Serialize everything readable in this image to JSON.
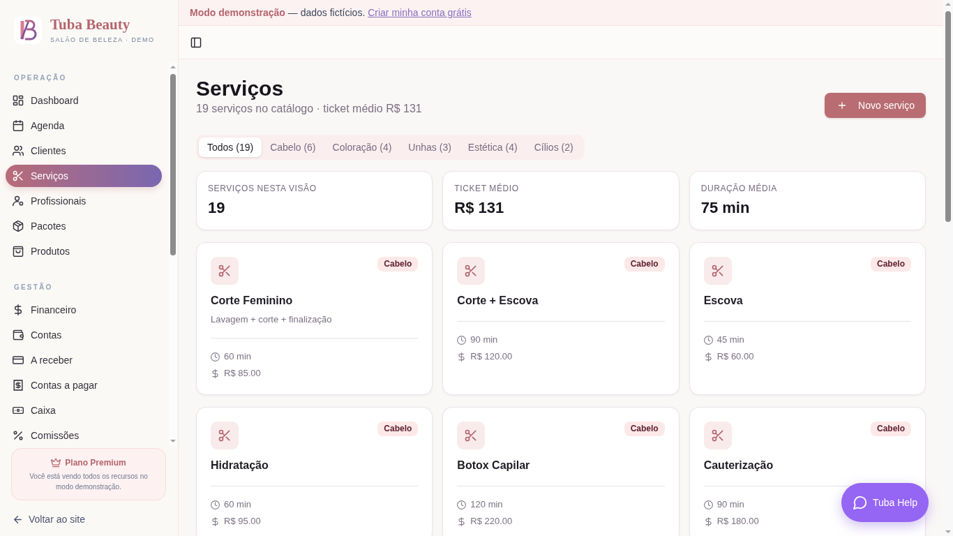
{
  "sidebar": {
    "brand": {
      "name": "Tuba Beauty",
      "tagline": "SALÃO DE BELEZA · DEMO"
    },
    "sections": [
      {
        "label": "OPERAÇÃO",
        "items": [
          {
            "label": "Dashboard",
            "selected": false
          },
          {
            "label": "Agenda",
            "selected": false
          },
          {
            "label": "Clientes",
            "selected": false
          },
          {
            "label": "Serviços",
            "selected": true
          },
          {
            "label": "Profissionais",
            "selected": false
          },
          {
            "label": "Pacotes",
            "selected": false
          },
          {
            "label": "Produtos",
            "selected": false
          }
        ]
      },
      {
        "label": "GESTÃO",
        "items": [
          {
            "label": "Financeiro",
            "selected": false
          },
          {
            "label": "Contas",
            "selected": false
          },
          {
            "label": "A receber",
            "selected": false
          },
          {
            "label": "Contas a pagar",
            "selected": false
          },
          {
            "label": "Caixa",
            "selected": false
          },
          {
            "label": "Comissões",
            "selected": false
          }
        ]
      }
    ],
    "plan_card": {
      "title": "Plano Premium",
      "text": "Você está vendo todos os recursos no modo demonstração."
    },
    "back_link": "Voltar ao site"
  },
  "demo_banner": {
    "label": "Modo demonstração",
    "text": "— dados fictícios.",
    "link": "Criar minha conta grátis"
  },
  "page": {
    "title": "Serviços",
    "subtitle": "19 serviços no catálogo · ticket médio R$ 131",
    "new_button": "Novo serviço",
    "filters": [
      {
        "label": "Todos (19)",
        "selected": true
      },
      {
        "label": "Cabelo (6)",
        "selected": false
      },
      {
        "label": "Coloração (4)",
        "selected": false
      },
      {
        "label": "Unhas (3)",
        "selected": false
      },
      {
        "label": "Estética (4)",
        "selected": false
      },
      {
        "label": "Cílios (2)",
        "selected": false
      }
    ],
    "stats": [
      {
        "label": "SERVIÇOS NESTA VISÃO",
        "value": "19"
      },
      {
        "label": "TICKET MÉDIO",
        "value": "R$ 131"
      },
      {
        "label": "DURAÇÃO MÉDIA",
        "value": "75 min"
      }
    ],
    "services": [
      {
        "name": "Corte Feminino",
        "category": "Cabelo",
        "description": "Lavagem + corte + finalização",
        "duration": "60 min",
        "price": "R$ 85.00"
      },
      {
        "name": "Corte + Escova",
        "category": "Cabelo",
        "duration": "90 min",
        "price": "R$ 120.00"
      },
      {
        "name": "Escova",
        "category": "Cabelo",
        "duration": "45 min",
        "price": "R$ 60.00"
      },
      {
        "name": "Hidratação",
        "category": "Cabelo",
        "duration": "60 min",
        "price": "R$ 95.00"
      },
      {
        "name": "Botox Capilar",
        "category": "Cabelo",
        "duration": "120 min",
        "price": "R$ 220.00"
      },
      {
        "name": "Cauterização",
        "category": "Cabelo",
        "duration": "90 min",
        "price": "R$ 180.00"
      }
    ]
  },
  "help_button": "Tuba Help"
}
